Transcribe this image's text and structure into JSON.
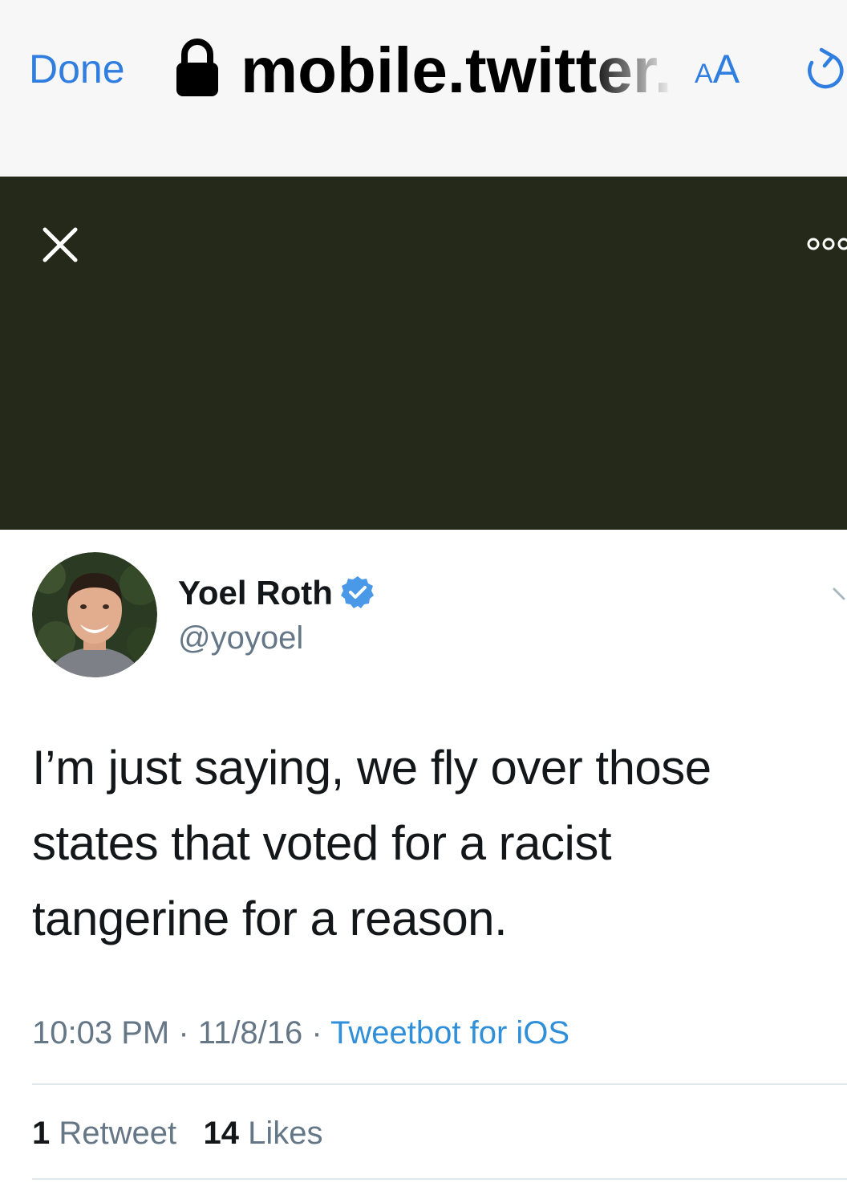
{
  "browser": {
    "done_label": "Done",
    "url": "mobile.twitter.com",
    "text_size_small": "A",
    "text_size_large": "A",
    "accent_color": "#2f7ee0"
  },
  "media_header": {
    "background_color": "#25291a",
    "close_icon": "close-icon",
    "more_icon": "more-options-icon"
  },
  "tweet": {
    "display_name": "Yoel Roth",
    "verified": true,
    "handle": "@yoyoel",
    "text": "I’m just saying, we fly over those states that voted for a racist tangerine for a reason.",
    "time": "10:03 PM",
    "separator": "·",
    "date": "11/8/16",
    "source": "Tweetbot for iOS",
    "retweet_count": "1",
    "retweet_label": "Retweet",
    "like_count": "14",
    "like_label": "Likes",
    "link_color": "#2f8fd8",
    "verified_color": "#4a99e9"
  }
}
